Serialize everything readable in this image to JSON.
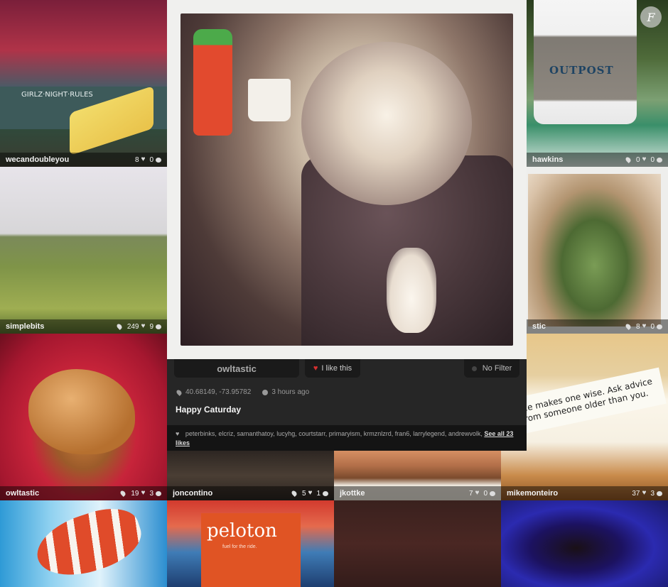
{
  "grid": {
    "tile1": {
      "user": "wecandoubleyou",
      "likes": "8",
      "comments": "0",
      "sign_text": "GIRLZ·NIGHT·RULES"
    },
    "tile2": {
      "user": "simplebits",
      "likes": "249",
      "comments": "9"
    },
    "tile3": {
      "user": "owltastic",
      "likes": "19",
      "comments": "3"
    },
    "tile4": {
      "user": "joncontino",
      "likes": "5",
      "comments": "1"
    },
    "tile5": {
      "user": "jkottke",
      "likes": "7",
      "comments": "0"
    },
    "tile6": {
      "user": "mikemonteiro",
      "likes": "37",
      "comments": "3",
      "fortune_text": "...e makes one wise. Ask advice from someone older than you."
    },
    "tile7": {
      "user": "hawkins",
      "likes": "0",
      "comments": "0",
      "cup_text": "OUTPOST"
    },
    "tile8": {
      "user": "stic",
      "likes": "8",
      "comments": "0"
    },
    "tile9": {
      "magazine_title": "peloton",
      "magazine_tagline": "fuel for the ride."
    }
  },
  "featured": {
    "username": "owltastic",
    "like_button": "I like this",
    "filter": "No Filter",
    "location": "40.68149, -73.95782",
    "time": "3 hours ago",
    "caption": "Happy Caturday",
    "likes_list": "peterbinks, elcriz, samanthatoy, lucyhg, courtstarr, primaryism, krmznlzrd, fran6, larrylegend, andrewvolk,",
    "see_all": "See all 23 likes"
  },
  "logo": "F"
}
